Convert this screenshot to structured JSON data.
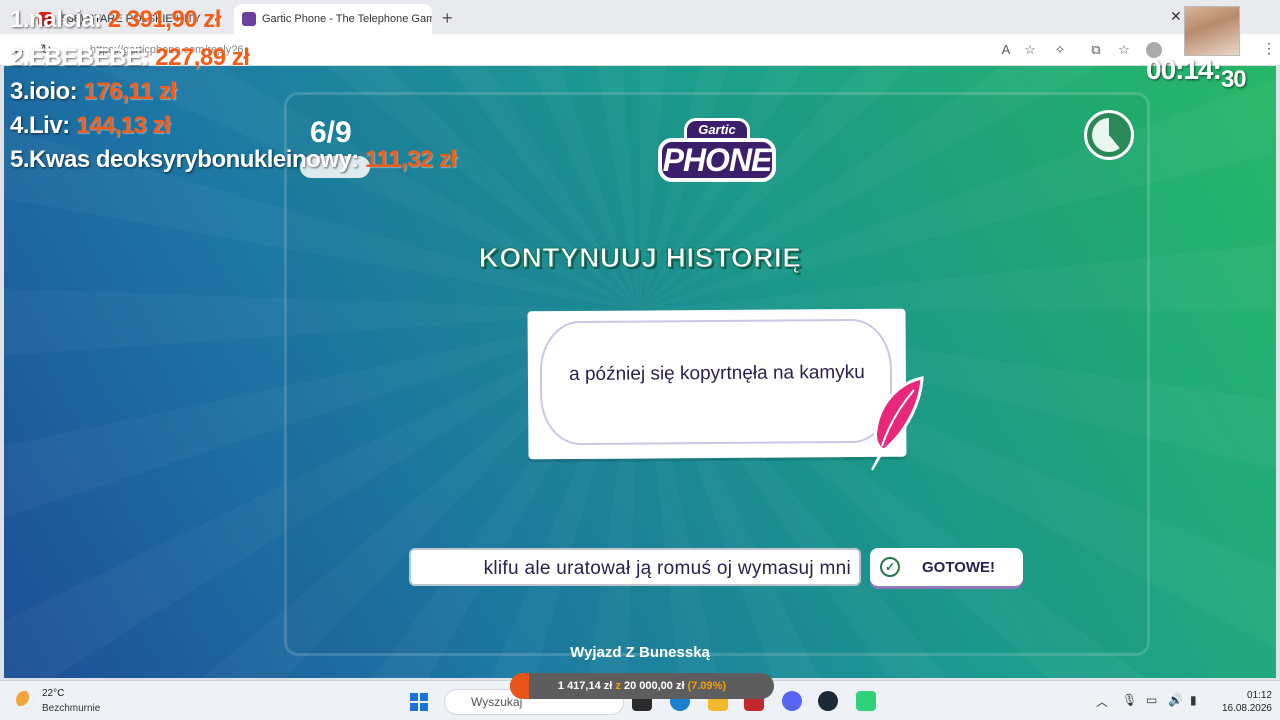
{
  "browser": {
    "tabs": [
      {
        "label": "(538) STARE POLSKIE HITY",
        "active": false
      },
      {
        "label": "Gartic Phone - The Telephone Game",
        "active": true
      }
    ],
    "url": "https://garticphone.com/reply?6"
  },
  "game": {
    "round": "6/9",
    "logo_top": "Gartic",
    "logo_main": "PHONE",
    "heading": "KONTYNUUJ HISTORIĘ",
    "prompt": "a później się kopyrtnęła na kamyku",
    "answer_value": "klifu ale uratował ją romuś oj wymasuj mni",
    "done_label": "GOTOWE!",
    "song": "Wyjazd Z Bunesską",
    "timer_remaining": 0.61
  },
  "overlay": {
    "leaderboard": [
      {
        "rank": "1.",
        "name": "nalcia:",
        "amount": "2 391,90 zł"
      },
      {
        "rank": "2.",
        "name": "EBEBEBE:",
        "amount": "227,89 zł"
      },
      {
        "rank": "3.",
        "name": "ioio:",
        "amount": "176,11 zł"
      },
      {
        "rank": "4.",
        "name": "Liv:",
        "amount": "144,13 zł"
      },
      {
        "rank": "5.",
        "name": "Kwas deoksyrybonukleinowy:",
        "amount": "111,32 zł"
      }
    ],
    "stream_timer_main": "00:14:",
    "stream_timer_sec": "30",
    "goal": {
      "current": "1 417,14 zł",
      "sep": "z",
      "target": "20 000,00 zł",
      "percent": "(7.09%)",
      "fraction": 0.0709
    }
  },
  "taskbar": {
    "weather_temp": "22°C",
    "weather_desc": "Bezchmurnie",
    "search_placeholder": "Wyszukaj",
    "time": "01:12",
    "date": "16.08.2026"
  },
  "colors": {
    "accent_orange": "#f25d1a",
    "panel_purple": "#3b1f6b",
    "text_dark": "#2b2050"
  }
}
